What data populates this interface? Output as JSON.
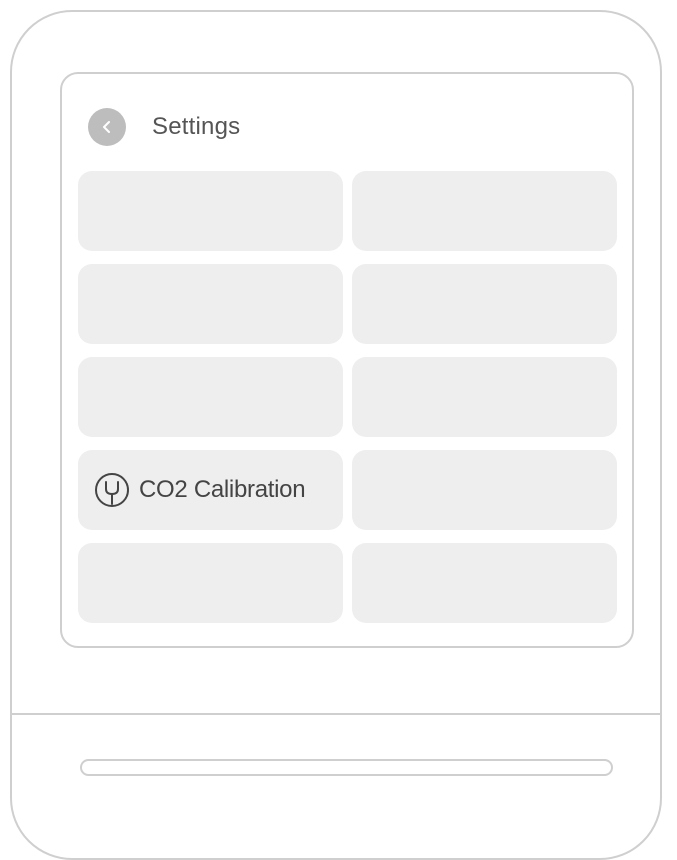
{
  "screen": {
    "title": "Settings",
    "back_icon": "chevron-left-icon"
  },
  "tiles": [
    {
      "label": "",
      "icon": ""
    },
    {
      "label": "",
      "icon": ""
    },
    {
      "label": "",
      "icon": ""
    },
    {
      "label": "",
      "icon": ""
    },
    {
      "label": "",
      "icon": ""
    },
    {
      "label": "",
      "icon": ""
    },
    {
      "label": "CO2 Calibration",
      "icon": "tuning-fork-icon"
    },
    {
      "label": "",
      "icon": ""
    },
    {
      "label": "",
      "icon": ""
    },
    {
      "label": "",
      "icon": ""
    }
  ],
  "colors": {
    "outline": "#cfcfcf",
    "tile_bg": "#eeeeee",
    "back_button": "#bdbdbd",
    "text": "#444444"
  }
}
